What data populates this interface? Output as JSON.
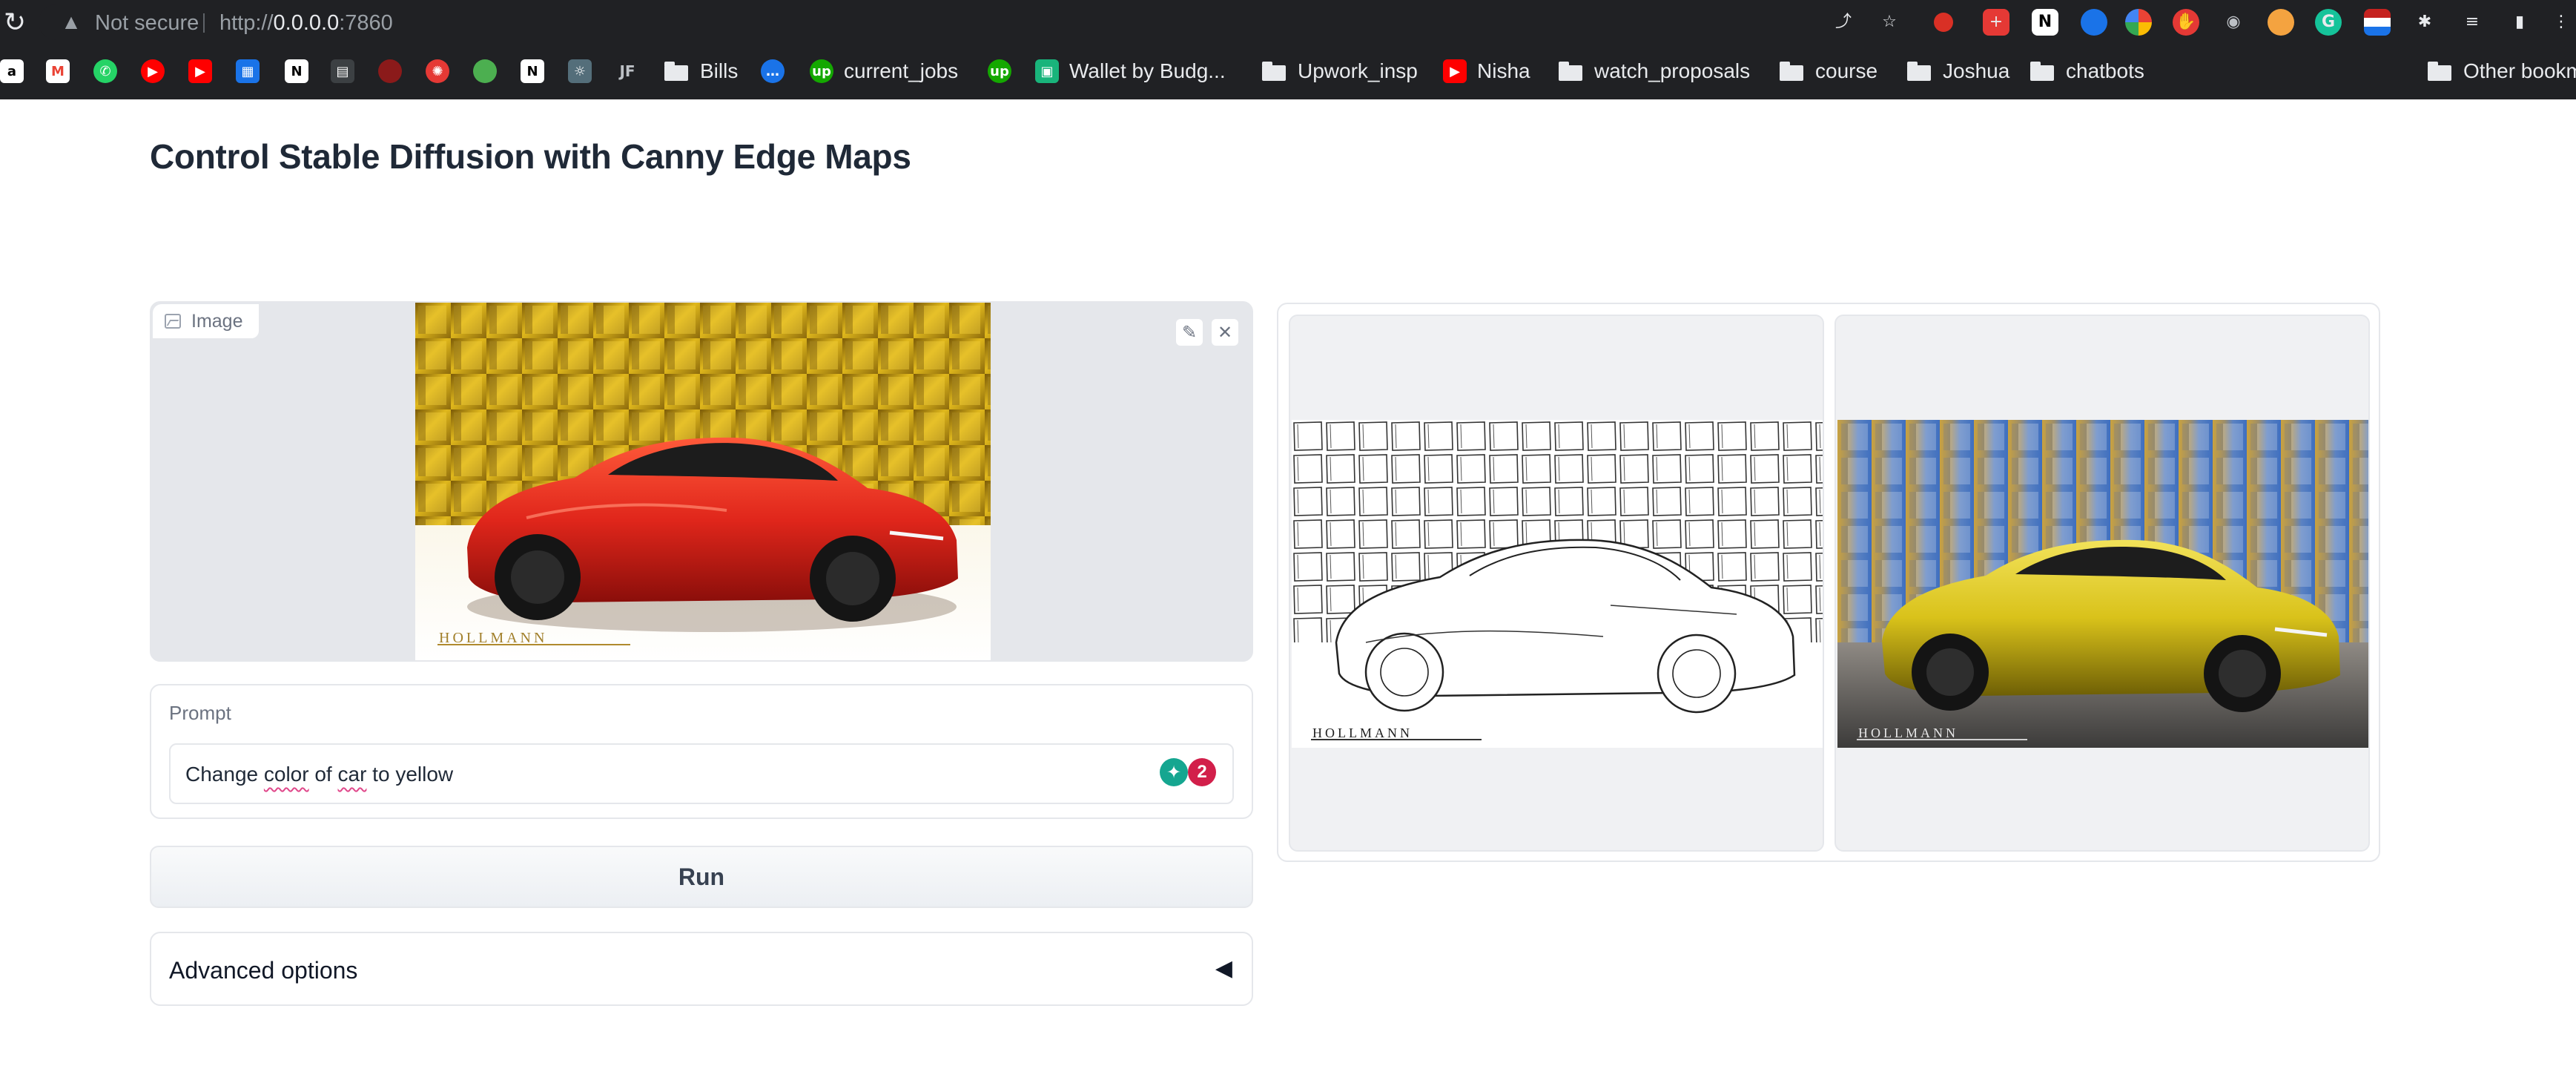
{
  "browser": {
    "security_label": "Not secure",
    "url_scheme": "http://",
    "url_host": "0.0.0.0",
    "url_port": ":7860",
    "bookmarks": [
      {
        "label": "Bills",
        "kind": "folder"
      },
      {
        "label": "current_jobs",
        "kind": "site",
        "icon": "upwork-icon",
        "color": "#14a800"
      },
      {
        "label": "Wallet by Budg...",
        "kind": "site",
        "icon": "wallet-icon",
        "color": "#19b47b"
      },
      {
        "label": "Upwork_insp",
        "kind": "folder"
      },
      {
        "label": "Nisha",
        "kind": "site",
        "icon": "youtube-icon",
        "color": "#ff0000"
      },
      {
        "label": "watch_proposals",
        "kind": "folder"
      },
      {
        "label": "course",
        "kind": "folder"
      },
      {
        "label": "Joshua",
        "kind": "folder"
      },
      {
        "label": "chatbots",
        "kind": "folder"
      },
      {
        "label": "Other bookm",
        "kind": "folder"
      }
    ]
  },
  "app": {
    "title": "Control Stable Diffusion with Canny Edge Maps",
    "image_input": {
      "label": "Image",
      "watermark": "HOLLMANN"
    },
    "prompt": {
      "label": "Prompt",
      "value_parts": [
        "Change ",
        "color",
        " of ",
        "car",
        " to yellow"
      ],
      "grammarly_count": "2"
    },
    "run_label": "Run",
    "advanced_label": "Advanced options",
    "gallery": {
      "watermark_edges": "HOLLMANN",
      "watermark_result": "HOLLMANN"
    }
  },
  "colors": {
    "accent_red_car": "#e0261b",
    "accent_yellow_car": "#d9c21a",
    "chrome_bg": "#202124"
  }
}
